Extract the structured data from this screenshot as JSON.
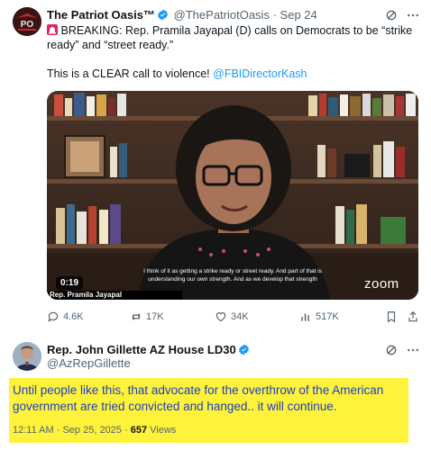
{
  "post": {
    "author_name": "The Patriot Oasis™",
    "author_handle": "@ThePatriotOasis",
    "separator": "·",
    "date": "Sep 24",
    "text_line1": "BREAKING: Rep. Pramila Jayapal (D) calls on Democrats to be “strike",
    "text_line2": "ready” and “street ready.”",
    "text_line3": "This is a CLEAR call to violence!",
    "mention": "@FBIDirectorKash",
    "video": {
      "duration": "0:19",
      "name_caption": "Rep. Pramila Jayapal",
      "caption_line1": "I think of it as getting a strike ready or street ready. And part of that is",
      "caption_line2": "understanding our own strength. And as we develop that strength",
      "watermark": "zoom"
    },
    "actions": {
      "replies": "4.6K",
      "reposts": "17K",
      "likes": "34K",
      "views": "517K"
    }
  },
  "reply": {
    "author_name": "Rep. John Gillette AZ House LD30",
    "author_handle": "@AzRepGillette",
    "text_line1": "Until people like this, that advocate for the overthrow of the American",
    "text_line2": "government are tried convicted and hanged..  it will continue.",
    "time": "12:11 AM",
    "separator": "·",
    "date": "Sep 25, 2025",
    "separator2": "·",
    "views_count": "657",
    "views_label": "Views"
  },
  "colors": {
    "accent": "#1d9bf0",
    "highlight": "#fff23a",
    "quote_text": "#1d3fc4",
    "siren": "#e0245e"
  },
  "icons": [
    "verified-badge-icon",
    "grok-icon",
    "more-icon",
    "siren-icon",
    "reply-icon",
    "repost-icon",
    "like-icon",
    "views-icon",
    "bookmark-icon",
    "share-icon"
  ]
}
